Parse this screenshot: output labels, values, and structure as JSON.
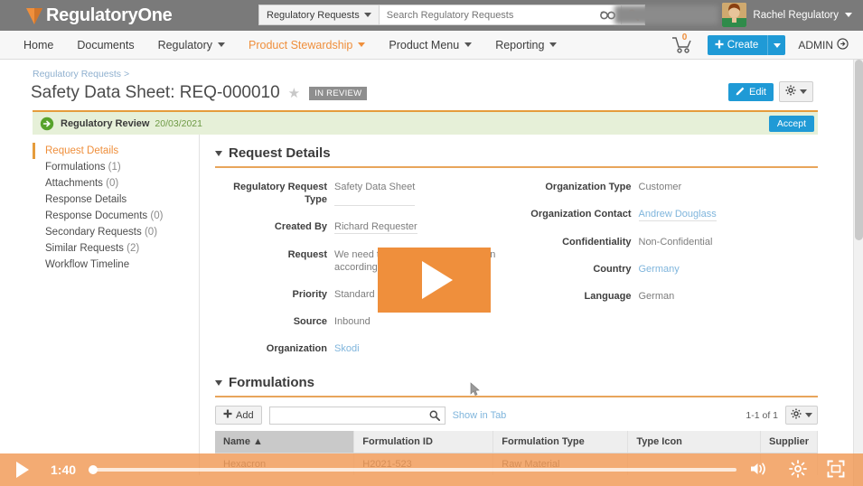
{
  "brand": {
    "name_first": "Regulatory",
    "name_second": "One",
    "logo_icon": "v-logo-icon"
  },
  "search": {
    "scope_label": "Regulatory Requests",
    "placeholder": "Search Regulatory Requests",
    "value": "",
    "glasses_icon": "glasses-icon",
    "search_icon": "search-icon"
  },
  "user": {
    "name": "Rachel Regulatory",
    "avatar_icon": "avatar",
    "caret_icon": "chevron-down-icon"
  },
  "nav": {
    "items": [
      {
        "label": "Home",
        "has_caret": false,
        "active": false
      },
      {
        "label": "Documents",
        "has_caret": false,
        "active": false
      },
      {
        "label": "Regulatory",
        "has_caret": true,
        "active": false
      },
      {
        "label": "Product Stewardship",
        "has_caret": true,
        "active": true
      },
      {
        "label": "Product Menu",
        "has_caret": true,
        "active": false
      },
      {
        "label": "Reporting",
        "has_caret": true,
        "active": false
      }
    ],
    "cart_icon": "shopping-cart-icon",
    "cart_count": "0",
    "create_label": "Create",
    "admin_label": "ADMIN",
    "admin_icon": "arrow-circle-right-icon"
  },
  "page": {
    "breadcrumb": "Regulatory Requests >",
    "title": "Safety Data Sheet: REQ-000010",
    "star_icon": "star-icon",
    "status_badge": "IN REVIEW",
    "edit_label": "Edit",
    "edit_icon": "pencil-icon",
    "gear_icon": "gear-icon"
  },
  "workflow": {
    "icon": "arrow-circle-right-green-icon",
    "label": "Regulatory Review",
    "date": "20/03/2021",
    "accept_label": "Accept"
  },
  "sidebar": {
    "items": [
      {
        "label": "Request Details",
        "count": "",
        "active": true
      },
      {
        "label": "Formulations",
        "count": "(1)",
        "active": false
      },
      {
        "label": "Attachments",
        "count": "(0)",
        "active": false
      },
      {
        "label": "Response Details",
        "count": "",
        "active": false
      },
      {
        "label": "Response Documents",
        "count": "(0)",
        "active": false
      },
      {
        "label": "Secondary Requests",
        "count": "(0)",
        "active": false
      },
      {
        "label": "Similar Requests",
        "count": "(2)",
        "active": false
      },
      {
        "label": "Workflow Timeline",
        "count": "",
        "active": false
      }
    ]
  },
  "request_details": {
    "section_title": "Request Details",
    "left": [
      {
        "label": "Regulatory Request Type",
        "value": "Safety Data Sheet",
        "kind": "text"
      },
      {
        "label": "Created By",
        "value": "Richard Requester",
        "kind": "text"
      },
      {
        "label": "Request",
        "value": "We need the SDS with Classification according latest EC Regulation",
        "kind": "text"
      },
      {
        "label": "Priority",
        "value": "Standard (10 days)",
        "kind": "text"
      },
      {
        "label": "Source",
        "value": "Inbound",
        "kind": "text"
      },
      {
        "label": "Organization",
        "value": "Skodi",
        "kind": "link"
      }
    ],
    "right": [
      {
        "label": "Organization Type",
        "value": "Customer",
        "kind": "text"
      },
      {
        "label": "Organization Contact",
        "value": "Andrew Douglass",
        "kind": "link"
      },
      {
        "label": "Confidentiality",
        "value": "Non-Confidential",
        "kind": "text"
      },
      {
        "label": "Country",
        "value": "Germany",
        "kind": "link"
      },
      {
        "label": "Language",
        "value": "German",
        "kind": "text"
      }
    ]
  },
  "formulations": {
    "section_title": "Formulations",
    "add_label": "Add",
    "search_value": "",
    "search_placeholder": "",
    "search_icon": "search-icon",
    "show_in_tab_label": "Show in Tab",
    "record_count": "1-1 of 1",
    "gear_icon": "gear-icon",
    "columns": [
      "Name",
      "Formulation ID",
      "Formulation Type",
      "Type Icon",
      "Supplier"
    ],
    "sort_column": "Name",
    "sort_direction_icon": "sort-asc-icon",
    "rows": [
      {
        "name": "Hexacron",
        "formulation_id": "H2021-523",
        "formulation_type": "Raw Material",
        "type_icon": "",
        "supplier": ""
      }
    ]
  },
  "video": {
    "play_icon": "play-icon",
    "overlay_play_icon": "play-overlay-icon",
    "time": "1:40",
    "progress_percent": 0,
    "volume_icon": "volume-icon",
    "settings_icon": "settings-gear-icon",
    "fullscreen_icon": "fullscreen-icon"
  },
  "colors": {
    "accent_orange": "#ef8f3c",
    "brand_gray": "#7a7a7a",
    "button_blue": "#1f9ad6",
    "banner_green": "#e6f0d8"
  }
}
